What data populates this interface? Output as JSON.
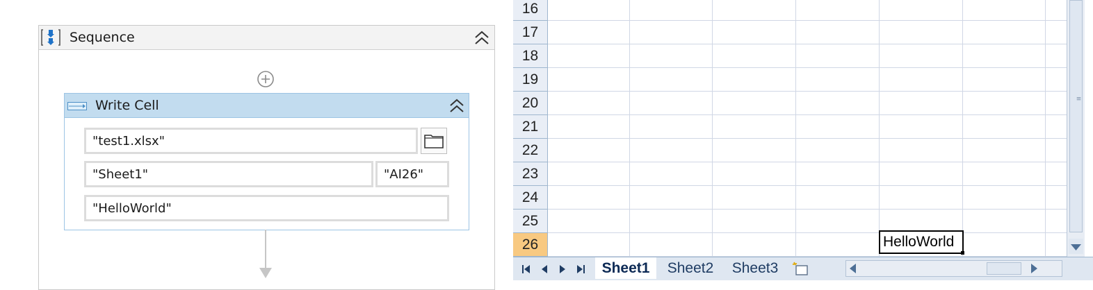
{
  "designer": {
    "sequence": {
      "title": "Sequence",
      "icon": "sequence-icon"
    },
    "activity": {
      "title": "Write Cell",
      "icon": "write-cell-icon",
      "workbook_path": "\"test1.xlsx\"",
      "sheet_name": "\"Sheet1\"",
      "cell": "\"AI26\"",
      "text": "\"HelloWorld\""
    }
  },
  "spreadsheet": {
    "rows": [
      "16",
      "17",
      "18",
      "19",
      "20",
      "21",
      "22",
      "23",
      "24",
      "25",
      "26"
    ],
    "active_row": "26",
    "active_cell_value": "HelloWorld",
    "tabs": [
      "Sheet1",
      "Sheet2",
      "Sheet3"
    ],
    "active_tab": "Sheet1"
  },
  "colors": {
    "activity_header": "#c2dcef",
    "row_header": "#e9eef6",
    "active_row_header": "#f8c981",
    "tab_bar": "#dfe7f1"
  }
}
